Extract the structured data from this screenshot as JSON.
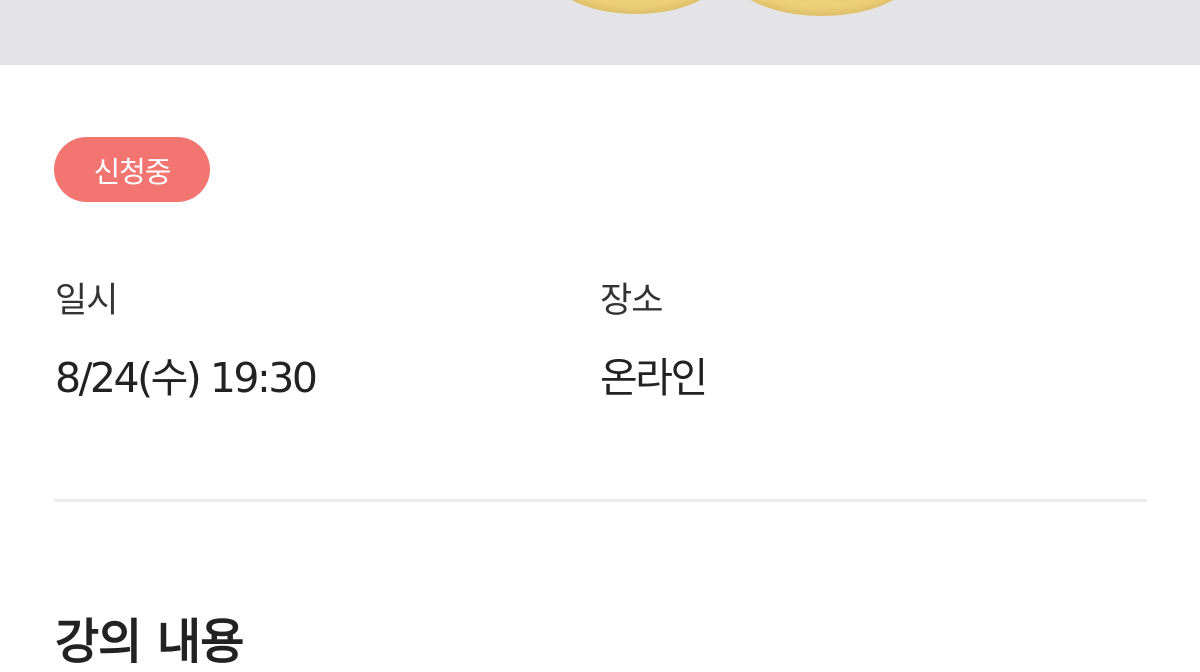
{
  "event": {
    "status": "신청중",
    "date_label": "일시",
    "date_value": "8/24(수) 19:30",
    "place_label": "장소",
    "place_value": "온라인"
  },
  "section": {
    "heading": "강의 내용"
  },
  "colors": {
    "status_badge": "#f37572",
    "hero_background": "#e4e4e6",
    "divider": "#ececec"
  }
}
